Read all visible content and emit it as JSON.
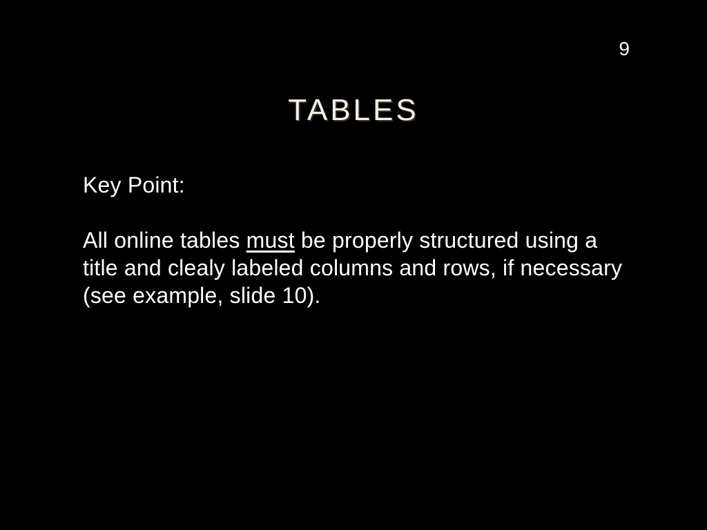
{
  "slide": {
    "number": "9",
    "title": "TABLES",
    "key_point_label": "Key Point:",
    "body_prefix": "All online tables ",
    "body_underlined": "must",
    "body_suffix": " be properly structured using a title and clealy labeled columns and rows, if necessary (see example, slide 10)."
  }
}
